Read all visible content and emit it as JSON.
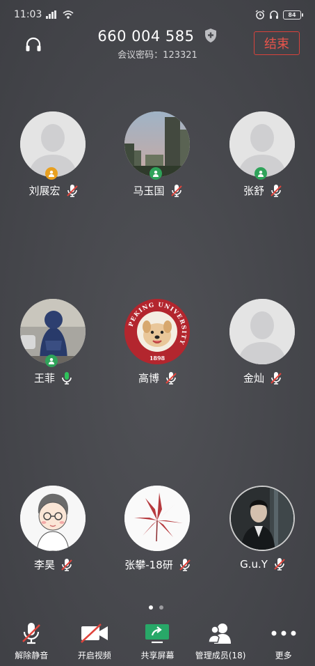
{
  "status_bar": {
    "time": "11:03",
    "battery": "84"
  },
  "header": {
    "meeting_id": "660 004 585",
    "password_label": "会议密码：123321",
    "end_label": "结束"
  },
  "participants": [
    {
      "name": "刘展宏",
      "avatar": "placeholder-avatar",
      "badge": "host",
      "mic": "muted"
    },
    {
      "name": "马玉国",
      "avatar": "city-sky-photo",
      "badge": "cohost",
      "mic": "muted"
    },
    {
      "name": "张舒",
      "avatar": "placeholder-avatar",
      "badge": "cohost",
      "mic": "muted"
    },
    {
      "name": "王菲",
      "avatar": "person-backview-photo",
      "badge": "cohost",
      "mic": "active"
    },
    {
      "name": "高博",
      "avatar": "university-dog-logo",
      "badge": "",
      "mic": "muted"
    },
    {
      "name": "金灿",
      "avatar": "placeholder-avatar",
      "badge": "",
      "mic": "muted"
    },
    {
      "name": "李昊",
      "avatar": "cartoon-boy",
      "badge": "",
      "mic": "muted"
    },
    {
      "name": "张攀-18研",
      "avatar": "red-leaf",
      "badge": "",
      "mic": "muted"
    },
    {
      "name": "G.u.Y",
      "avatar": "man-portrait-photo",
      "badge": "",
      "mic": "muted"
    }
  ],
  "avatar_text": {
    "university_ring": "PEKING UNIVERSITY",
    "university_year": "1898"
  },
  "pagination": {
    "pages": 2,
    "current": 1
  },
  "toolbar": [
    {
      "label": "解除静音",
      "icon": "mic-muted-icon"
    },
    {
      "label": "开启视频",
      "icon": "video-off-icon"
    },
    {
      "label": "共享屏幕",
      "icon": "share-screen-icon"
    },
    {
      "label": "管理成员(18)",
      "icon": "members-icon"
    },
    {
      "label": "更多",
      "icon": "more-icon"
    }
  ],
  "colors": {
    "background": "#4a4b50",
    "end_red": "#e8544b",
    "host_badge": "#e8a020",
    "cohost_badge": "#2fa35a",
    "active_mic": "#2fc25b",
    "muted_red": "#e0443c",
    "share_green": "#28a868"
  }
}
